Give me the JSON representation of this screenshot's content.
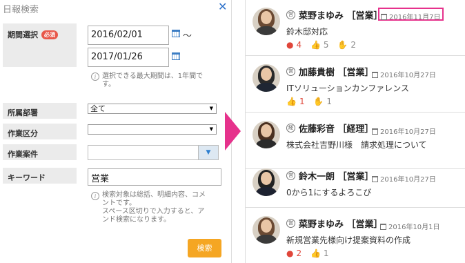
{
  "search": {
    "title": "日報検索",
    "close_icon": "close-icon",
    "period_label": "期間選択",
    "required_badge": "必須",
    "date_from": "2016/02/01",
    "date_to": "2017/01/26",
    "tilde": "～",
    "period_note_line1": "選択できる最大期間は、1年間で",
    "period_note_line2": "す。",
    "department_label": "所属部署",
    "department_value": "全て",
    "work_type_label": "作業区分",
    "work_type_value": "",
    "project_label": "作業案件",
    "keyword_label": "キーワード",
    "keyword_value": "営業",
    "keyword_note_line1": "検索対象は総括、明細内容、コメ",
    "keyword_note_line2": "ントです。",
    "keyword_note_line3": "スペース区切りで入力すると、ア",
    "keyword_note_line4": "ンド検索になります。",
    "search_button": "検索"
  },
  "accent_color": "#e6328c",
  "button_color": "#f5a623",
  "reports": [
    {
      "role_icon": "営",
      "name": "菜野まゆみ ［営業］",
      "date": "2016年11月7日",
      "title": "鈴木邸対応",
      "comments": "4",
      "likes": "5",
      "claps": "2",
      "highlighted": true
    },
    {
      "role_icon": "営",
      "name": "加藤貴樹 ［営業］",
      "date": "2016年10月27日",
      "title": "ITソリューションカンファレンス",
      "likes": "1",
      "claps": "1"
    },
    {
      "role_icon": "経",
      "name": "佐藤彩音 ［経理］",
      "date": "2016年10月27日",
      "title": "株式会社吉野川様　請求処理について"
    },
    {
      "role_icon": "営",
      "name": "鈴木一朗 ［営業］",
      "date": "2016年10月27日",
      "title": "0から1にするよろこび"
    },
    {
      "role_icon": "営",
      "name": "菜野まゆみ ［営業］",
      "date": "2016年10月1日",
      "title": "新規営業先様向け提案資料の作成",
      "comments": "2",
      "likes": "1"
    }
  ]
}
